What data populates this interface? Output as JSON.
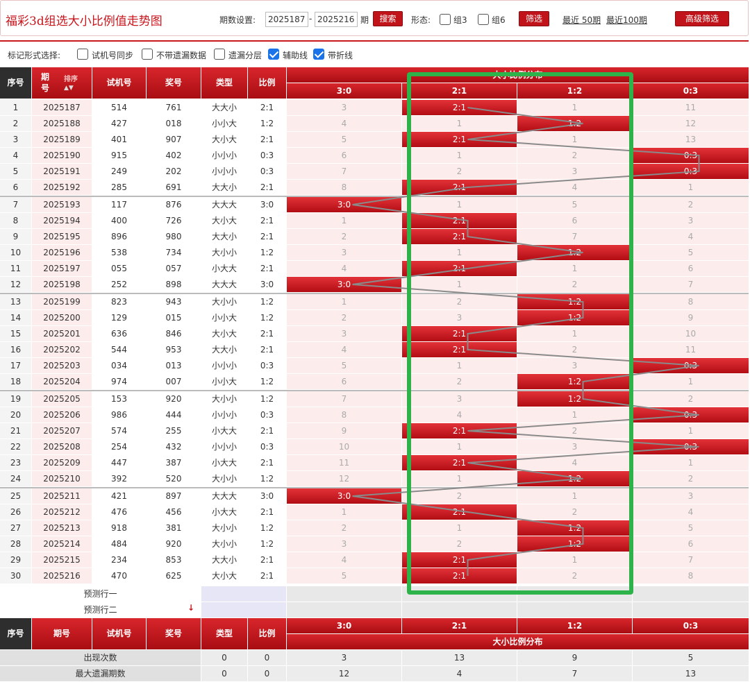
{
  "title": "福彩3d组选大小比例值走势图",
  "header": {
    "period_label": "期数设置:",
    "from": "2025187",
    "dash": "-",
    "to": "2025216",
    "qi": "期",
    "search": "搜索",
    "form_label": "形态:",
    "group3": "组3",
    "group6": "组6",
    "filter": "筛选",
    "recent50": "最近 50期",
    "recent100": "最近100期",
    "advanced": "高级筛选"
  },
  "options": {
    "label": "标记形式选择:",
    "items": [
      {
        "label": "试机号同步",
        "checked": false
      },
      {
        "label": "不带遗漏数据",
        "checked": false
      },
      {
        "label": "遗漏分层",
        "checked": false
      },
      {
        "label": "辅助线",
        "checked": true
      },
      {
        "label": "带折线",
        "checked": true
      }
    ]
  },
  "columns": {
    "seq": "序号",
    "period": "期号",
    "sort": "排序",
    "trial": "试机号",
    "prize": "奖号",
    "type": "类型",
    "ratio": "比例",
    "group": "大小比例分布",
    "ratios": [
      "3:0",
      "2:1",
      "1:2",
      "0:3"
    ]
  },
  "rows": [
    {
      "seq": "1",
      "period": "2025187",
      "trial": "514",
      "prize": "761",
      "type": "大大小",
      "ratio": "2:1",
      "hit": 1,
      "cells": [
        "3",
        "2:1",
        "1",
        "11"
      ]
    },
    {
      "seq": "2",
      "period": "2025188",
      "trial": "427",
      "prize": "018",
      "type": "小小大",
      "ratio": "1:2",
      "hit": 2,
      "cells": [
        "4",
        "1",
        "1:2",
        "12"
      ]
    },
    {
      "seq": "3",
      "period": "2025189",
      "trial": "401",
      "prize": "907",
      "type": "大小大",
      "ratio": "2:1",
      "hit": 1,
      "cells": [
        "5",
        "2:1",
        "1",
        "13"
      ]
    },
    {
      "seq": "4",
      "period": "2025190",
      "trial": "915",
      "prize": "402",
      "type": "小小小",
      "ratio": "0:3",
      "hit": 3,
      "cells": [
        "6",
        "1",
        "2",
        "0:3"
      ]
    },
    {
      "seq": "5",
      "period": "2025191",
      "trial": "249",
      "prize": "202",
      "type": "小小小",
      "ratio": "0:3",
      "hit": 3,
      "cells": [
        "7",
        "2",
        "3",
        "0:3"
      ]
    },
    {
      "seq": "6",
      "period": "2025192",
      "trial": "285",
      "prize": "691",
      "type": "大大小",
      "ratio": "2:1",
      "hit": 1,
      "cells": [
        "8",
        "2:1",
        "4",
        "1"
      ]
    },
    {
      "seq": "7",
      "period": "2025193",
      "trial": "117",
      "prize": "876",
      "type": "大大大",
      "ratio": "3:0",
      "hit": 0,
      "cells": [
        "3:0",
        "1",
        "5",
        "2"
      ]
    },
    {
      "seq": "8",
      "period": "2025194",
      "trial": "400",
      "prize": "726",
      "type": "大小大",
      "ratio": "2:1",
      "hit": 1,
      "cells": [
        "1",
        "2:1",
        "6",
        "3"
      ]
    },
    {
      "seq": "9",
      "period": "2025195",
      "trial": "896",
      "prize": "980",
      "type": "大大小",
      "ratio": "2:1",
      "hit": 1,
      "cells": [
        "2",
        "2:1",
        "7",
        "4"
      ]
    },
    {
      "seq": "10",
      "period": "2025196",
      "trial": "538",
      "prize": "734",
      "type": "大小小",
      "ratio": "1:2",
      "hit": 2,
      "cells": [
        "3",
        "1",
        "1:2",
        "5"
      ]
    },
    {
      "seq": "11",
      "period": "2025197",
      "trial": "055",
      "prize": "057",
      "type": "小大大",
      "ratio": "2:1",
      "hit": 1,
      "cells": [
        "4",
        "2:1",
        "1",
        "6"
      ]
    },
    {
      "seq": "12",
      "period": "2025198",
      "trial": "252",
      "prize": "898",
      "type": "大大大",
      "ratio": "3:0",
      "hit": 0,
      "cells": [
        "3:0",
        "1",
        "2",
        "7"
      ]
    },
    {
      "seq": "13",
      "period": "2025199",
      "trial": "823",
      "prize": "943",
      "type": "大小小",
      "ratio": "1:2",
      "hit": 2,
      "cells": [
        "1",
        "2",
        "1:2",
        "8"
      ]
    },
    {
      "seq": "14",
      "period": "2025200",
      "trial": "129",
      "prize": "015",
      "type": "小小大",
      "ratio": "1:2",
      "hit": 2,
      "cells": [
        "2",
        "3",
        "1:2",
        "9"
      ]
    },
    {
      "seq": "15",
      "period": "2025201",
      "trial": "636",
      "prize": "846",
      "type": "大小大",
      "ratio": "2:1",
      "hit": 1,
      "cells": [
        "3",
        "2:1",
        "1",
        "10"
      ]
    },
    {
      "seq": "16",
      "period": "2025202",
      "trial": "544",
      "prize": "953",
      "type": "大大小",
      "ratio": "2:1",
      "hit": 1,
      "cells": [
        "4",
        "2:1",
        "2",
        "11"
      ]
    },
    {
      "seq": "17",
      "period": "2025203",
      "trial": "034",
      "prize": "013",
      "type": "小小小",
      "ratio": "0:3",
      "hit": 3,
      "cells": [
        "5",
        "1",
        "3",
        "0:3"
      ]
    },
    {
      "seq": "18",
      "period": "2025204",
      "trial": "974",
      "prize": "007",
      "type": "小小大",
      "ratio": "1:2",
      "hit": 2,
      "cells": [
        "6",
        "2",
        "1:2",
        "1"
      ]
    },
    {
      "seq": "19",
      "period": "2025205",
      "trial": "153",
      "prize": "920",
      "type": "大小小",
      "ratio": "1:2",
      "hit": 2,
      "cells": [
        "7",
        "3",
        "1:2",
        "2"
      ]
    },
    {
      "seq": "20",
      "period": "2025206",
      "trial": "986",
      "prize": "444",
      "type": "小小小",
      "ratio": "0:3",
      "hit": 3,
      "cells": [
        "8",
        "4",
        "1",
        "0:3"
      ]
    },
    {
      "seq": "21",
      "period": "2025207",
      "trial": "574",
      "prize": "255",
      "type": "小大大",
      "ratio": "2:1",
      "hit": 1,
      "cells": [
        "9",
        "2:1",
        "2",
        "1"
      ]
    },
    {
      "seq": "22",
      "period": "2025208",
      "trial": "254",
      "prize": "432",
      "type": "小小小",
      "ratio": "0:3",
      "hit": 3,
      "cells": [
        "10",
        "1",
        "3",
        "0:3"
      ]
    },
    {
      "seq": "23",
      "period": "2025209",
      "trial": "447",
      "prize": "387",
      "type": "小大大",
      "ratio": "2:1",
      "hit": 1,
      "cells": [
        "11",
        "2:1",
        "4",
        "1"
      ]
    },
    {
      "seq": "24",
      "period": "2025210",
      "trial": "392",
      "prize": "520",
      "type": "大小小",
      "ratio": "1:2",
      "hit": 2,
      "cells": [
        "12",
        "1",
        "1:2",
        "2"
      ]
    },
    {
      "seq": "25",
      "period": "2025211",
      "trial": "421",
      "prize": "897",
      "type": "大大大",
      "ratio": "3:0",
      "hit": 0,
      "cells": [
        "3:0",
        "2",
        "1",
        "3"
      ]
    },
    {
      "seq": "26",
      "period": "2025212",
      "trial": "476",
      "prize": "456",
      "type": "小大大",
      "ratio": "2:1",
      "hit": 1,
      "cells": [
        "1",
        "2:1",
        "2",
        "4"
      ]
    },
    {
      "seq": "27",
      "period": "2025213",
      "trial": "918",
      "prize": "381",
      "type": "大小小",
      "ratio": "1:2",
      "hit": 2,
      "cells": [
        "2",
        "1",
        "1:2",
        "5"
      ]
    },
    {
      "seq": "28",
      "period": "2025214",
      "trial": "484",
      "prize": "920",
      "type": "大小小",
      "ratio": "1:2",
      "hit": 2,
      "cells": [
        "3",
        "2",
        "1:2",
        "6"
      ]
    },
    {
      "seq": "29",
      "period": "2025215",
      "trial": "234",
      "prize": "853",
      "type": "大大小",
      "ratio": "2:1",
      "hit": 1,
      "cells": [
        "4",
        "2:1",
        "1",
        "7"
      ]
    },
    {
      "seq": "30",
      "period": "2025216",
      "trial": "470",
      "prize": "625",
      "type": "大小大",
      "ratio": "2:1",
      "hit": 1,
      "cells": [
        "5",
        "2:1",
        "2",
        "8"
      ]
    }
  ],
  "predict": [
    "预测行一",
    "预测行二"
  ],
  "footer": {
    "stats": [
      {
        "label": "出现次数",
        "type": "0",
        "ratio": "0",
        "values": [
          "3",
          "13",
          "9",
          "5"
        ]
      },
      {
        "label": "最大遗漏期数",
        "type": "0",
        "ratio": "0",
        "values": [
          "12",
          "4",
          "7",
          "13"
        ]
      }
    ]
  },
  "colors": {
    "accent": "#c8161d",
    "highlight": "#2eb24a"
  }
}
